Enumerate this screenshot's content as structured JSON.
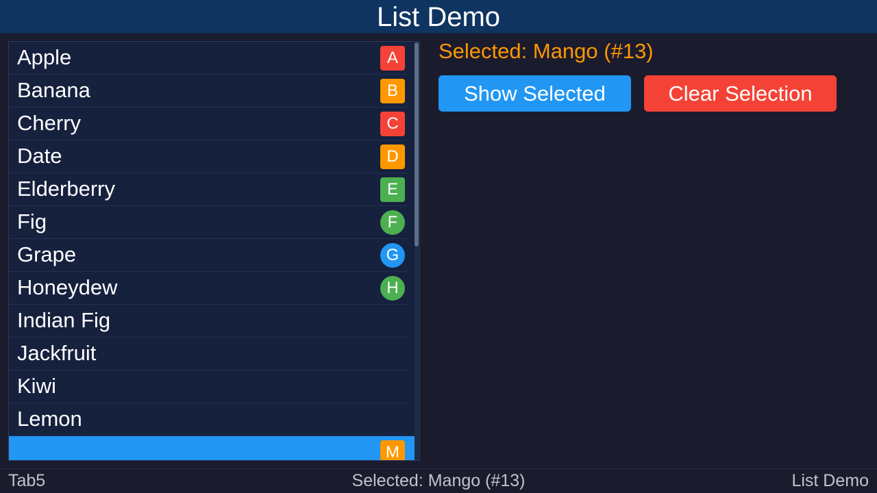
{
  "header": {
    "title": "List Demo"
  },
  "list": {
    "items": [
      {
        "label": "Apple",
        "badge": "A",
        "badge_color": "#f44336",
        "badge_shape": "square"
      },
      {
        "label": "Banana",
        "badge": "B",
        "badge_color": "#ff9800",
        "badge_shape": "square"
      },
      {
        "label": "Cherry",
        "badge": "C",
        "badge_color": "#f44336",
        "badge_shape": "square"
      },
      {
        "label": "Date",
        "badge": "D",
        "badge_color": "#ff9800",
        "badge_shape": "square"
      },
      {
        "label": "Elderberry",
        "badge": "E",
        "badge_color": "#4caf50",
        "badge_shape": "square"
      },
      {
        "label": "Fig",
        "badge": "F",
        "badge_color": "#4caf50",
        "badge_shape": "circle"
      },
      {
        "label": "Grape",
        "badge": "G",
        "badge_color": "#2196f3",
        "badge_shape": "circle"
      },
      {
        "label": "Honeydew",
        "badge": "H",
        "badge_color": "#4caf50",
        "badge_shape": "circle"
      },
      {
        "label": "Indian Fig",
        "badge": "",
        "badge_color": "",
        "badge_shape": ""
      },
      {
        "label": "Jackfruit",
        "badge": "",
        "badge_color": "",
        "badge_shape": ""
      },
      {
        "label": "Kiwi",
        "badge": "",
        "badge_color": "",
        "badge_shape": ""
      },
      {
        "label": "Lemon",
        "badge": "",
        "badge_color": "",
        "badge_shape": ""
      },
      {
        "label": "",
        "badge": "M",
        "badge_color": "#ff9800",
        "badge_shape": "square",
        "selected": true
      }
    ],
    "selection_color": "#2196f3"
  },
  "details": {
    "selected_text": "Selected: Mango (#13)",
    "show_button": "Show Selected",
    "clear_button": "Clear Selection"
  },
  "status": {
    "left": "Tab5",
    "center": "Selected: Mango (#13)",
    "right": "List Demo"
  }
}
